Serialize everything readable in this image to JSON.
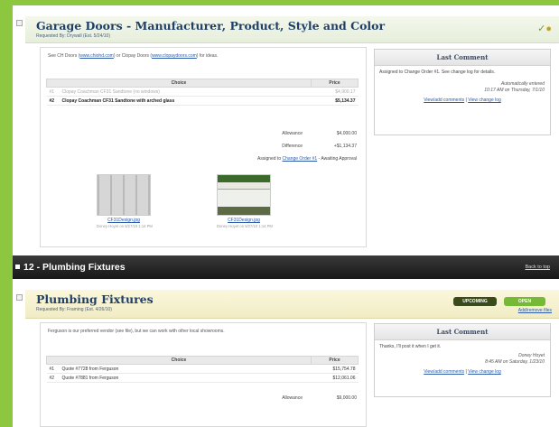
{
  "garage": {
    "title": "Garage Doors - Manufacturer, Product, Style and Color",
    "subtitle": "Requested By: Drywall (Est. 5/24/10)",
    "note_prefix": "See CH Doors (",
    "note_link1": "www.chiohd.com",
    "note_mid": ") or Clopay Doors (",
    "note_link2": "www.clopaydoors.com",
    "note_suffix": ") for ideas.",
    "table_headers": {
      "choice": "Choice",
      "price": "Price"
    },
    "rows": [
      {
        "num": "#1",
        "choice": "Clopay Coachman CF31 Sandtone (no windows)",
        "price": "$4,900.17"
      },
      {
        "num": "#2",
        "choice": "Clopay Coachman CF31 Sandtone with arched glass",
        "price": "$5,134.37"
      }
    ],
    "allowance_label": "Allowance",
    "allowance_value": "$4,000.00",
    "difference_label": "Difference",
    "difference_value": "+$1,134.37",
    "assigned_prefix": "Assigned to ",
    "assigned_link": "Change Order #1",
    "assigned_suffix": " - Awaiting Approval",
    "thumbs": [
      {
        "caption": "CF31Design.jpg",
        "sub": "Doney Hoyet on 5/27/10 1:14 PM"
      },
      {
        "caption": "CF31Design.jpg",
        "sub": "Doney Hoyet on 5/27/10 1:14 PM"
      }
    ],
    "comment": {
      "title": "Last Comment",
      "text": "Assigned to Change Order #1. See change log for details.",
      "author": "Automatically entered",
      "time": "10:17 AM on Thursday, 7/1/10",
      "link_comments": "View/add comments",
      "link_sep": " | ",
      "link_log": "View change log"
    }
  },
  "band": {
    "title": "12 - Plumbing Fixtures",
    "back_link": "Back to top"
  },
  "plumbing": {
    "title": "Plumbing Fixtures",
    "subtitle": "Requested By: Framing (Est. 4/26/10)",
    "badge_upcoming": "UPCOMING",
    "badge_open": "OPEN",
    "add_link": "Add/remove files",
    "note": "Ferguson is our preferred vendor (see file), but we can work with other local showrooms.",
    "table_headers": {
      "choice": "Choice",
      "price": "Price"
    },
    "rows": [
      {
        "num": "#1",
        "choice": "Quote #7728 from Ferguson",
        "price": "$15,754.78"
      },
      {
        "num": "#2",
        "choice": "Quote #7881 from Ferguson",
        "price": "$12,061.06"
      }
    ],
    "allowance_label": "Allowance",
    "allowance_value": "$9,000.00",
    "comment": {
      "title": "Last Comment",
      "text": "Thanks, I'll post it when I get it.",
      "author": "Doney Hoyet",
      "time": "8:45 AM on Saturday, 1/23/10",
      "link_comments": "View/add comments",
      "link_sep": " | ",
      "link_log": "View change log"
    }
  }
}
